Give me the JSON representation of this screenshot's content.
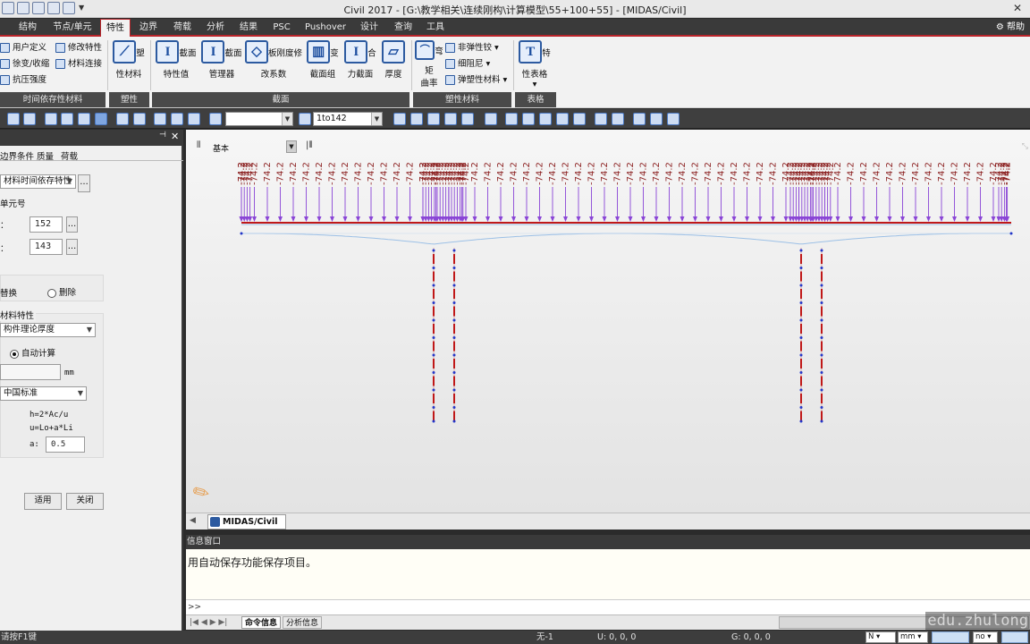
{
  "window": {
    "title": "Civil 2017 - [G:\\教学相关\\连续刚构\\计算模型\\55+100+55] - [MIDAS/Civil]",
    "close": "✕"
  },
  "menu": {
    "tabs": [
      "结构",
      "节点/单元",
      "特性",
      "边界",
      "荷载",
      "分析",
      "结果",
      "PSC",
      "Pushover",
      "设计",
      "查询",
      "工具"
    ],
    "active": "特性",
    "help": "帮助"
  },
  "ribbon": {
    "tdm": {
      "user_defined": "用户定义",
      "creep_shrink": "徐变/收缩",
      "comp_strength": "抗压强度",
      "modify": "修改特性",
      "link": "材料连接",
      "group": "时间依存性材料"
    },
    "plastic": {
      "material": "塑性材料",
      "group": "塑性"
    },
    "section": {
      "items": [
        "截面特性值",
        "截面管理器",
        "板刚度修改系数",
        "变截面组",
        "合力截面",
        "厚度"
      ],
      "group": "截面"
    },
    "plastic_mat": {
      "mc": [
        "弯矩",
        "曲率"
      ],
      "nonlinear": "非弹性铰",
      "damper": "细阻尼",
      "elasto": "弹塑性材料",
      "group": "塑性材料"
    },
    "table": {
      "label": "特性表格",
      "group": "表格"
    }
  },
  "toolbar": {
    "select_combo": "",
    "range_combo": "1to142"
  },
  "left_panel": {
    "tabs": [
      "边界条件",
      "质量",
      "荷载"
    ],
    "dropdown": "材料时间依存特性",
    "section_label": "单元号",
    "f1_label": "：",
    "f1_value": "152",
    "f2_label": "：",
    "f2_value": "143",
    "radio_replace": "替换",
    "radio_delete": "删除",
    "mat_title": "材料特性",
    "thickness_select": "构件理论厚度",
    "auto_calc": "自动计算",
    "unit": "mm",
    "code_select": "中国标准",
    "formula1": "h=2*Ac/u",
    "formula2": "u=Lo+a*Li",
    "a_label": "a:",
    "a_value": "0.5",
    "apply": "适用",
    "close": "关闭"
  },
  "view": {
    "combo": "基本",
    "load_value": "-74.2",
    "tab": "MIDAS/Civil"
  },
  "info": {
    "head": "信息窗口",
    "message": "用自动保存功能保存项目。",
    "prompt": ">>",
    "tabs": [
      "命令信息",
      "分析信息"
    ]
  },
  "watermark": "edu.zhulong",
  "status": {
    "hint": "请按F1键",
    "none": "无-1",
    "u": "U: 0, 0, 0",
    "g": "G: 0, 0, 0",
    "unit_force": "N",
    "unit_len": "mm",
    "no": "no"
  },
  "colors": {
    "accent": "#b8242a",
    "load": "#8a1d1d",
    "arrow": "#8a45d6",
    "pier": "#c01818",
    "node": "#2236c8"
  }
}
